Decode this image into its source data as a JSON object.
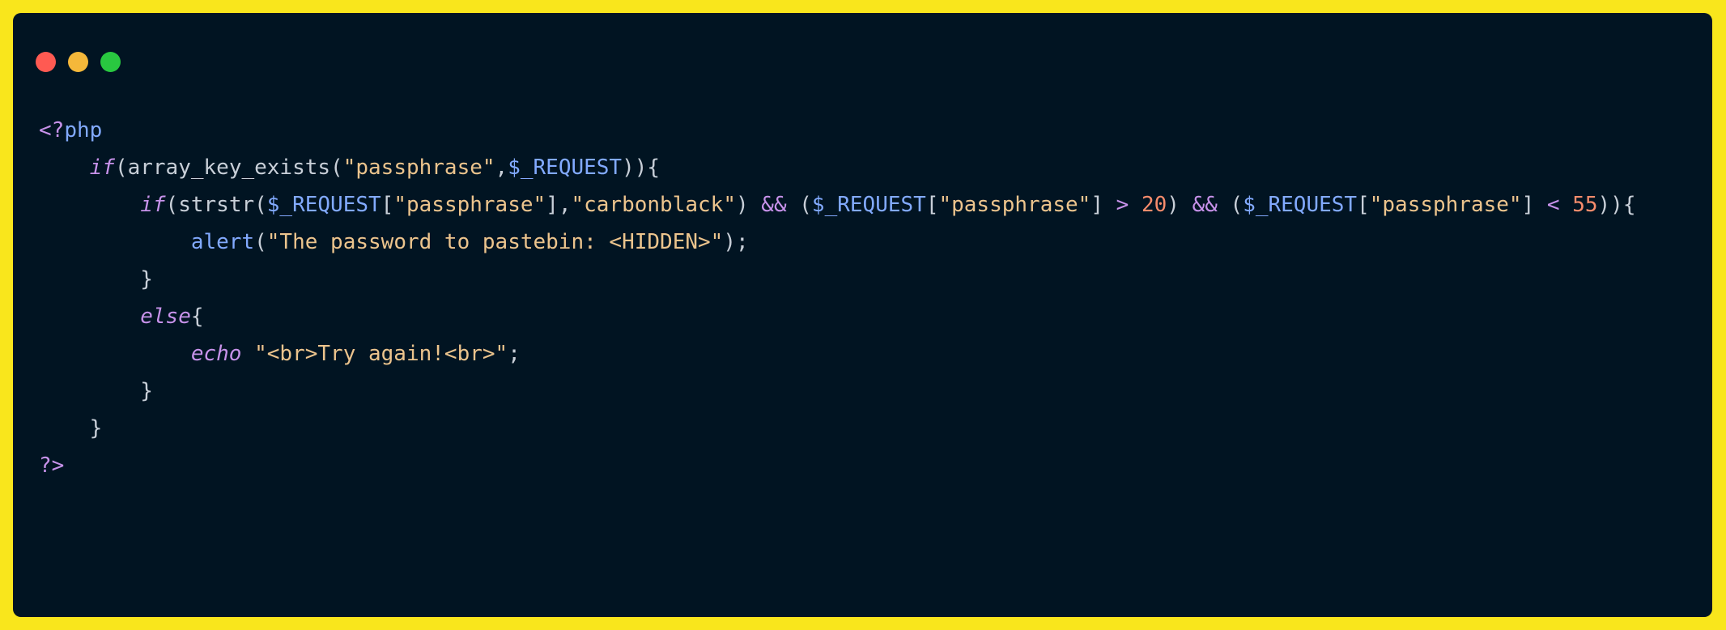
{
  "window": {
    "controls": [
      "close",
      "minimize",
      "maximize"
    ],
    "colors": {
      "close": "#ff5a52",
      "minimize": "#f5b83a",
      "maximize": "#29c840"
    }
  },
  "code": {
    "language": "php",
    "lines": [
      [
        {
          "t": "tag",
          "v": "<?"
        },
        {
          "t": "php",
          "v": "php"
        }
      ],
      [
        {
          "t": "pl",
          "v": "    "
        },
        {
          "t": "kw",
          "v": "if"
        },
        {
          "t": "pl",
          "v": "(array_key_exists("
        },
        {
          "t": "str",
          "v": "\"passphrase\""
        },
        {
          "t": "pl",
          "v": ","
        },
        {
          "t": "var",
          "v": "$_REQUEST"
        },
        {
          "t": "pl",
          "v": ")){"
        }
      ],
      [
        {
          "t": "pl",
          "v": "        "
        },
        {
          "t": "kw",
          "v": "if"
        },
        {
          "t": "pl",
          "v": "(strstr("
        },
        {
          "t": "var",
          "v": "$_REQUEST"
        },
        {
          "t": "pl",
          "v": "["
        },
        {
          "t": "str",
          "v": "\"passphrase\""
        },
        {
          "t": "pl",
          "v": "],"
        },
        {
          "t": "str",
          "v": "\"carbonblack\""
        },
        {
          "t": "pl",
          "v": ") "
        },
        {
          "t": "op",
          "v": "&&"
        },
        {
          "t": "pl",
          "v": " ("
        },
        {
          "t": "var",
          "v": "$_REQUEST"
        },
        {
          "t": "pl",
          "v": "["
        },
        {
          "t": "str",
          "v": "\"passphrase\""
        },
        {
          "t": "pl",
          "v": "] "
        },
        {
          "t": "op",
          "v": ">"
        },
        {
          "t": "pl",
          "v": " "
        },
        {
          "t": "num",
          "v": "20"
        },
        {
          "t": "pl",
          "v": ") "
        },
        {
          "t": "op",
          "v": "&&"
        },
        {
          "t": "pl",
          "v": " ("
        },
        {
          "t": "var",
          "v": "$_REQUEST"
        },
        {
          "t": "pl",
          "v": "["
        },
        {
          "t": "str",
          "v": "\"passphrase\""
        },
        {
          "t": "pl",
          "v": "] "
        },
        {
          "t": "op",
          "v": "<"
        },
        {
          "t": "pl",
          "v": " "
        },
        {
          "t": "num",
          "v": "55"
        },
        {
          "t": "pl",
          "v": ")){"
        }
      ],
      [
        {
          "t": "pl",
          "v": "            "
        },
        {
          "t": "fn",
          "v": "alert"
        },
        {
          "t": "pl",
          "v": "("
        },
        {
          "t": "str",
          "v": "\"The password to pastebin: <HIDDEN>\""
        },
        {
          "t": "pl",
          "v": ");"
        }
      ],
      [
        {
          "t": "pl",
          "v": "        }"
        }
      ],
      [
        {
          "t": "pl",
          "v": "        "
        },
        {
          "t": "kw",
          "v": "else"
        },
        {
          "t": "pl",
          "v": "{"
        }
      ],
      [
        {
          "t": "pl",
          "v": "            "
        },
        {
          "t": "kw",
          "v": "echo"
        },
        {
          "t": "pl",
          "v": " "
        },
        {
          "t": "str",
          "v": "\"<br>Try again!<br>\""
        },
        {
          "t": "pl",
          "v": ";"
        }
      ],
      [
        {
          "t": "pl",
          "v": "        }"
        }
      ],
      [
        {
          "t": "pl",
          "v": "    }"
        }
      ],
      [
        {
          "t": "tag",
          "v": "?>"
        }
      ]
    ]
  }
}
